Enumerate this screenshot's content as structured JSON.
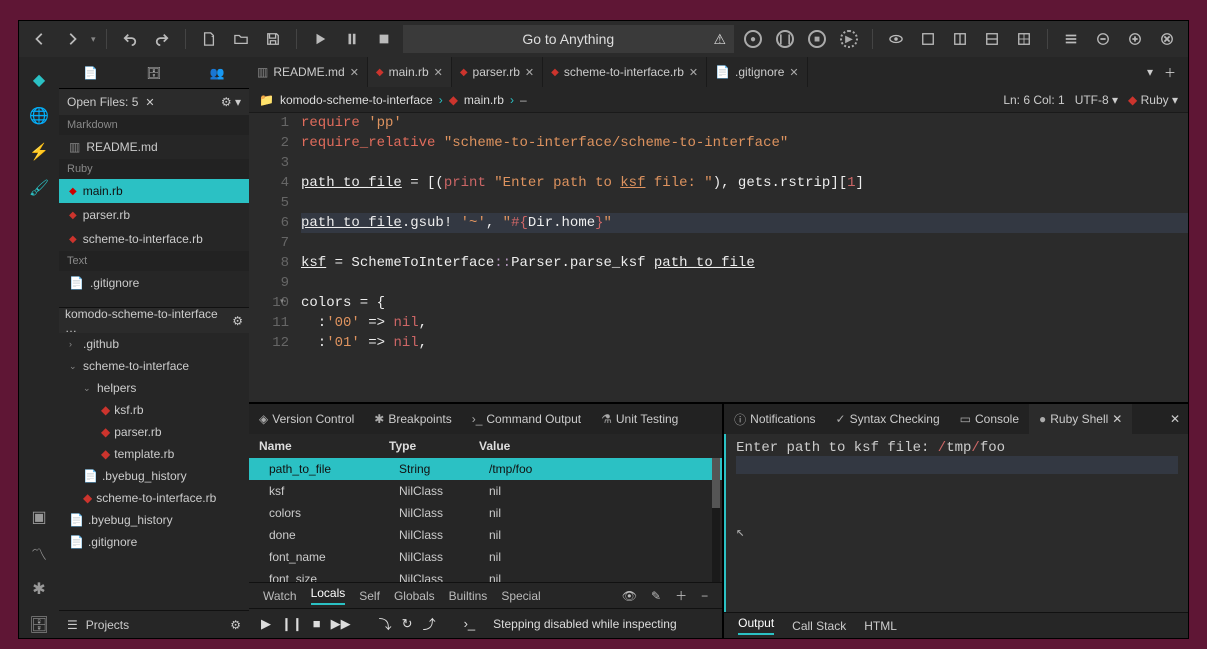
{
  "topbar": {
    "search_label": "Go to Anything"
  },
  "sidebar": {
    "open_files_label": "Open Files: 5",
    "sections": {
      "markdown": "Markdown",
      "ruby": "Ruby",
      "text": "Text"
    },
    "files": {
      "readme": "README.md",
      "main": "main.rb",
      "parser": "parser.rb",
      "scheme": "scheme-to-interface.rb",
      "gitignore": ".gitignore"
    },
    "project_name": "komodo-scheme-to-interface …",
    "tree": {
      "github": ".github",
      "sti": "scheme-to-interface",
      "helpers": "helpers",
      "ksf": "ksf.rb",
      "parser": "parser.rb",
      "template": "template.rb",
      "byebug1": ".byebug_history",
      "scheme": "scheme-to-interface.rb",
      "byebug2": ".byebug_history",
      "gitignore": ".gitignore"
    },
    "projects_label": "Projects"
  },
  "tabs": {
    "readme": "README.md",
    "main": "main.rb",
    "parser": "parser.rb",
    "scheme": "scheme-to-interface.rb",
    "gitignore": ".gitignore"
  },
  "breadcrumb": {
    "folder": "komodo-scheme-to-interface",
    "file": "main.rb",
    "pos": "Ln: 6 Col: 1",
    "encoding": "UTF-8",
    "lang": "Ruby"
  },
  "code": {
    "l1a": "require",
    "l1b": "'pp'",
    "l2a": "require_relative",
    "l2b": "\"scheme-to-interface/scheme-to-interface\"",
    "l4a": "path_to_file",
    "l4b": " = [(",
    "l4c": "print",
    "l4d": " \"Enter path to ",
    "l4dk": "ksf",
    "l4de": " file: \"",
    "l4e": "), gets.rstrip][",
    "l4f": "1",
    "l4g": "]",
    "l6a": "path_to_file",
    "l6b": ".gsub! ",
    "l6c": "'~'",
    "l6d": ", ",
    "l6e": "\"",
    "l6f": "#{",
    "l6g": "Dir",
    "l6h": ".home",
    "l6i": "}",
    "l6j": "\"",
    "l8a": "ksf",
    "l8b": " = SchemeToInterface",
    "l8c": "::",
    "l8d": "Parser",
    "l8e": ".parse_ksf ",
    "l8f": "path_to_file",
    "l10a": "colors = {",
    "l11a": "  :",
    "l11b": "'00'",
    "l11c": " => ",
    "l11d": "nil",
    "l11e": ",",
    "l12a": "  :",
    "l12b": "'01'",
    "l12c": " => ",
    "l12d": "nil",
    "l12e": ","
  },
  "bottom": {
    "tabs": {
      "vc": "Version Control",
      "bp": "Breakpoints",
      "co": "Command Output",
      "ut": "Unit Testing",
      "nt": "Notifications",
      "sc": "Syntax Checking",
      "cs": "Console",
      "rs": "Ruby Shell"
    },
    "locals_head": {
      "name": "Name",
      "type": "Type",
      "value": "Value"
    },
    "locals": [
      {
        "name": "path_to_file",
        "type": "String",
        "value": "/tmp/foo"
      },
      {
        "name": "ksf",
        "type": "NilClass",
        "value": "nil"
      },
      {
        "name": "colors",
        "type": "NilClass",
        "value": "nil"
      },
      {
        "name": "done",
        "type": "NilClass",
        "value": "nil"
      },
      {
        "name": "font_name",
        "type": "NilClass",
        "value": "nil"
      },
      {
        "name": "font_size",
        "type": "NilClass",
        "value": "nil"
      }
    ],
    "foot_tabs": {
      "watch": "Watch",
      "locals": "Locals",
      "self": "Self",
      "globals": "Globals",
      "builtins": "Builtins",
      "special": "Special"
    },
    "dbg_status": "Stepping disabled while inspecting",
    "shell_prompt": "Enter path to ksf file: ",
    "shell_input_a": "/",
    "shell_input_b": "tmp",
    "shell_input_c": "/",
    "shell_input_d": "foo",
    "shell_foot": {
      "output": "Output",
      "callstack": "Call Stack",
      "html": "HTML"
    }
  }
}
